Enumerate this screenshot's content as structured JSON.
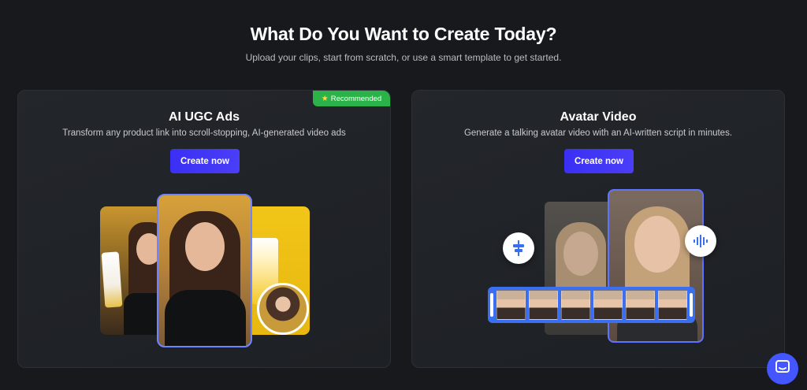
{
  "header": {
    "title": "What Do You Want to Create Today?",
    "subtitle": "Upload your clips, start from scratch, or use a smart template to get started."
  },
  "cards": [
    {
      "title": "AI UGC Ads",
      "description": "Transform any product link into scroll-stopping, AI-generated video ads",
      "button_label": "Create now",
      "badge": "Recommended",
      "badge_icon": "star-icon"
    },
    {
      "title": "Avatar Video",
      "description": "Generate a talking avatar video with an AI-written script in minutes.",
      "button_label": "Create now"
    }
  ],
  "colors": {
    "background": "#17191d",
    "accent": "#3b2ff5",
    "badge": "#2bb34a",
    "film_strip": "#3a6ff2",
    "chat_button": "#4456ff"
  },
  "icons": {
    "chat": "chat-icon",
    "left_tool": "timeline-icon",
    "right_tool": "audio-wave-icon"
  }
}
